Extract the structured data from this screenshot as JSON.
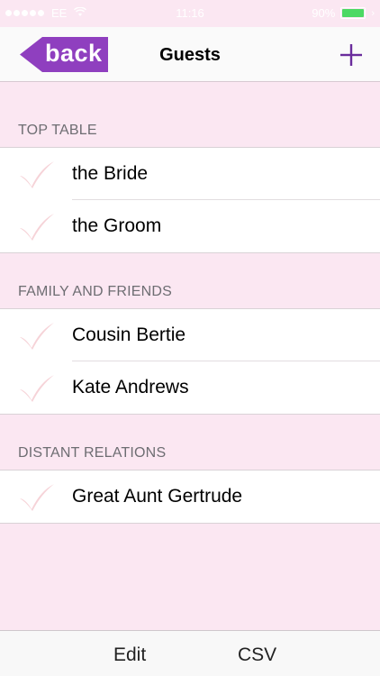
{
  "status_bar": {
    "carrier": "EE",
    "time": "11:16",
    "battery_percent": "90%",
    "signal_dots": 5,
    "battery_color": "#4cd964"
  },
  "nav": {
    "back_label": "back",
    "title": "Guests",
    "add_icon": "plus-icon",
    "accent_color": "#8f3fbf"
  },
  "sections": [
    {
      "header": "TOP TABLE",
      "rows": [
        {
          "name": "the Bride",
          "icon": "check-icon"
        },
        {
          "name": "the Groom",
          "icon": "check-icon"
        }
      ]
    },
    {
      "header": "FAMILY AND FRIENDS",
      "rows": [
        {
          "name": "Cousin Bertie",
          "icon": "check-icon"
        },
        {
          "name": "Kate Andrews",
          "icon": "check-icon"
        }
      ]
    },
    {
      "header": "DISTANT RELATIONS",
      "rows": [
        {
          "name": "Great Aunt Gertrude",
          "icon": "check-icon"
        }
      ]
    }
  ],
  "toolbar": {
    "edit_label": "Edit",
    "csv_label": "CSV"
  },
  "colors": {
    "background": "#fbe7f2",
    "check": "#f6d3d8"
  }
}
